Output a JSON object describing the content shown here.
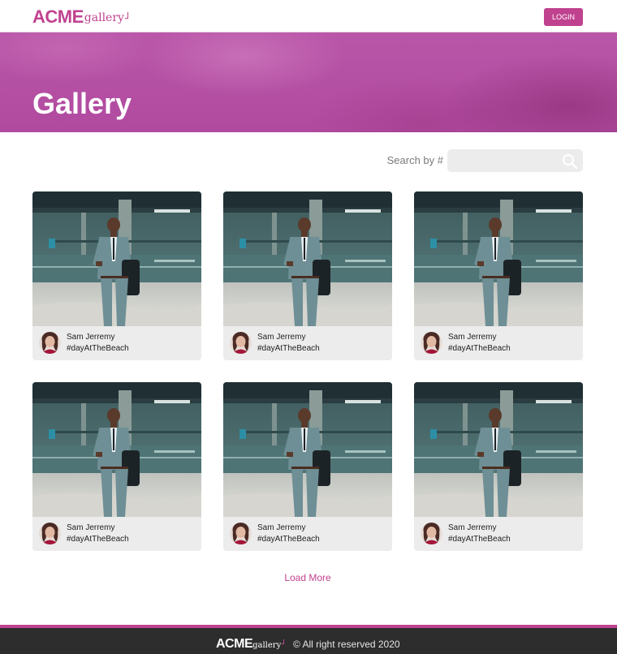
{
  "header": {
    "logo_primary": "ACME",
    "logo_secondary": "gallery",
    "login_label": "LOGIN",
    "brand_color": "#c0428f"
  },
  "hero": {
    "title": "Gallery"
  },
  "search": {
    "label": "Search by #",
    "value": "",
    "placeholder": "",
    "icon": "search-icon"
  },
  "cards": [
    {
      "name": "Sam Jerremy",
      "tag": "#dayAtTheBeach"
    },
    {
      "name": "Sam Jerremy",
      "tag": "#dayAtTheBeach"
    },
    {
      "name": "Sam Jerremy",
      "tag": "#dayAtTheBeach"
    },
    {
      "name": "Sam Jerremy",
      "tag": "#dayAtTheBeach"
    },
    {
      "name": "Sam Jerremy",
      "tag": "#dayAtTheBeach"
    },
    {
      "name": "Sam Jerremy",
      "tag": "#dayAtTheBeach"
    }
  ],
  "load_more_label": "Load More",
  "footer": {
    "logo_primary": "ACME",
    "logo_secondary": "gallery",
    "copyright": "© All right reserved 2020"
  }
}
